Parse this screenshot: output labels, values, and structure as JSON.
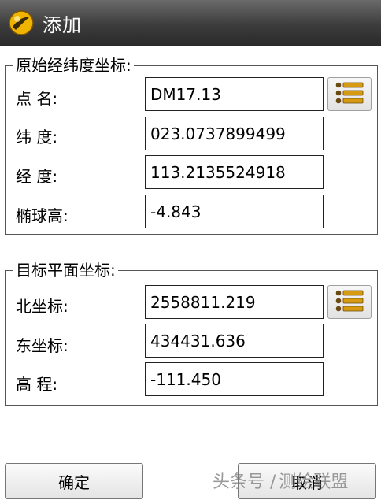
{
  "window": {
    "title": "添加",
    "logo_icon": "app-logo-icon"
  },
  "original_coords": {
    "title": "原始经纬度坐标:",
    "point_name": {
      "label": "点 名:",
      "value": "DM17.13"
    },
    "latitude": {
      "label": "纬 度:",
      "value": "023.0737899499"
    },
    "longitude": {
      "label": "经 度:",
      "value": "113.2135524918"
    },
    "ellipsoid_height": {
      "label": "椭球高:",
      "value": "-4.843"
    },
    "list_button_icon": "list-icon"
  },
  "target_coords": {
    "title": "目标平面坐标:",
    "north": {
      "label": "北坐标:",
      "value": "2558811.219"
    },
    "east": {
      "label": "东坐标:",
      "value": "434431.636"
    },
    "elevation": {
      "label": "高 程:",
      "value": "-111.450"
    },
    "list_button_icon": "list-icon"
  },
  "buttons": {
    "ok": "确定",
    "cancel": "取消"
  },
  "watermark": {
    "prefix": "头条号 /",
    "name": "测绘联盟"
  },
  "colors": {
    "titlebar": "#3c3c3c",
    "icon_accent": "#f0b400",
    "icon_dark": "#6a4a10"
  }
}
